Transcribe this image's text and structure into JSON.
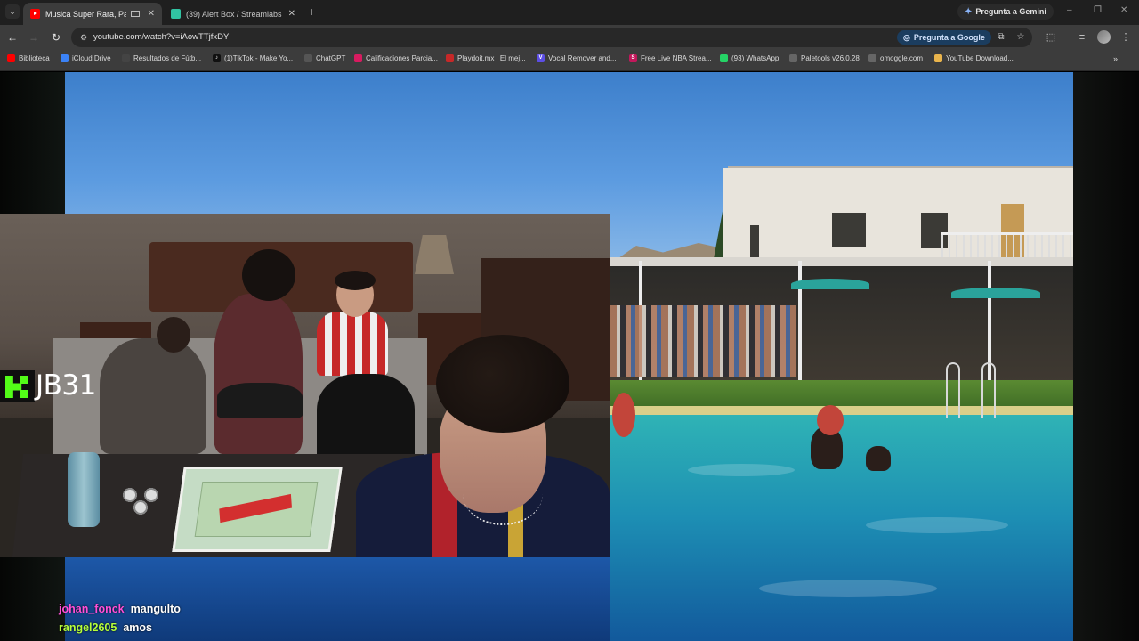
{
  "colors": {
    "chrome_dark": "#1f1f1f",
    "chrome_toolbar": "#3c3c3c",
    "omnibox": "#282828",
    "ask_google_bg": "#1b3d5f",
    "kick_green": "#53fc18"
  },
  "browser": {
    "tabs": [
      {
        "title": "Musica Super Rara, Para Go",
        "favicon": "youtube-icon",
        "active": true
      },
      {
        "title": "(39) Alert Box / Streamlabs",
        "favicon": "streamlabs-icon",
        "active": false
      }
    ],
    "tab_search_icon": "chevron-down-icon",
    "new_tab_icon": "plus-icon",
    "gemini_button": "Pregunta a Gemini",
    "window_controls": [
      "minimize-icon",
      "restore-icon",
      "close-icon"
    ]
  },
  "toolbar": {
    "url": "youtube.com/watch?v=iAowTTjfxDY",
    "ask_google": "Pregunta a Google",
    "icons": [
      "back-icon",
      "forward-icon",
      "reload-icon",
      "site-info-icon",
      "cast-icon",
      "star-icon",
      "extensions-icon",
      "reading-list-icon",
      "profile-avatar",
      "menu-icon"
    ]
  },
  "bookmarks": [
    {
      "label": "Biblioteca",
      "icon": "youtube-icon",
      "color": "#ff0000"
    },
    {
      "label": "iCloud Drive",
      "icon": "folder-icon",
      "color": "#3b82f6"
    },
    {
      "label": "Resultados de Fútb...",
      "icon": "365-icon",
      "color": "#444444"
    },
    {
      "label": "(1)TikTok - Make Yo...",
      "icon": "tiktok-icon",
      "color": "#111111"
    },
    {
      "label": "ChatGPT",
      "icon": "chatgpt-icon",
      "color": "#555555"
    },
    {
      "label": "Calificaciones Parcia...",
      "icon": "diamond-icon",
      "color": "#d81b60"
    },
    {
      "label": "Playdoit.mx | El mej...",
      "icon": "playdoit-icon",
      "color": "#c62828"
    },
    {
      "label": "Vocal Remover and...",
      "icon": "v-icon",
      "color": "#5c4ee5"
    },
    {
      "label": "Free Live NBA Strea...",
      "icon": "s-icon",
      "color": "#c2185b"
    },
    {
      "label": "(93) WhatsApp",
      "icon": "whatsapp-icon",
      "color": "#25d366"
    },
    {
      "label": "Paletools v26.0.28",
      "icon": "globe-icon",
      "color": "#666666"
    },
    {
      "label": "omoggle.com",
      "icon": "globe-icon",
      "color": "#666666"
    },
    {
      "label": "YouTube Download...",
      "icon": "gem-icon",
      "color": "#e9b44c"
    }
  ],
  "bookmarks_more_icon": "chevron-right-icon",
  "stream": {
    "channel_name": "JB31",
    "logo": "kick-logo-icon",
    "chat": [
      {
        "user": "johan_fonck",
        "message": "mangulto",
        "color": "#ff4fd8"
      },
      {
        "user": "rangel2605",
        "message": "amos",
        "color": "#b6ff3a"
      }
    ]
  }
}
